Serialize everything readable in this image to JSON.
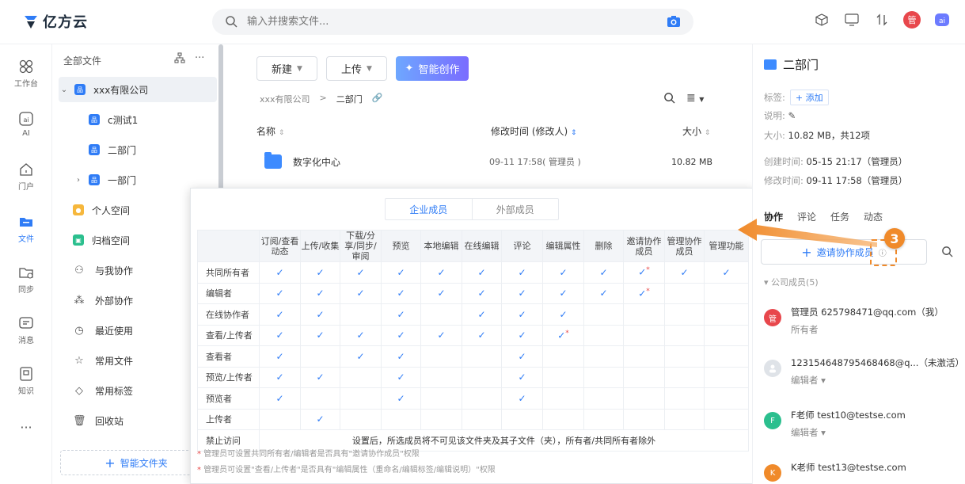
{
  "app": {
    "brand": "亿方云",
    "search_placeholder": "输入并搜索文件...",
    "user_avatar": "管"
  },
  "rail": [
    {
      "label": "工作台",
      "icon": "grid-icon"
    },
    {
      "label": "AI",
      "icon": "ai-icon"
    },
    {
      "label": "门户",
      "icon": "home-icon"
    },
    {
      "label": "文件",
      "icon": "folder-icon",
      "active": true
    },
    {
      "label": "同步",
      "icon": "sync-folder-icon"
    },
    {
      "label": "消息",
      "icon": "message-icon"
    },
    {
      "label": "知识",
      "icon": "knowledge-icon"
    }
  ],
  "tree": {
    "title": "全部文件",
    "items": [
      {
        "label": "xxx有限公司"
      },
      {
        "label": "c测试1"
      },
      {
        "label": "二部门"
      },
      {
        "label": "一部门"
      },
      {
        "label": "个人空间"
      },
      {
        "label": "归档空间"
      },
      {
        "label": "与我协作"
      },
      {
        "label": "外部协作"
      },
      {
        "label": "最近使用"
      },
      {
        "label": "常用文件"
      },
      {
        "label": "常用标签"
      },
      {
        "label": "回收站"
      }
    ],
    "smart_folder": "智能文件夹"
  },
  "main": {
    "new_btn": "新建",
    "upload_btn": "上传",
    "ai_btn": "智能创作",
    "crumb_root": "xxx有限公司",
    "crumb_sep": ">",
    "crumb_current": "二部门",
    "col_name": "名称",
    "col_mtime": "修改时间 (修改人)",
    "col_size": "大小",
    "files": [
      {
        "name": "数字化中心",
        "mtime": "09-11 17:58( 管理员 )",
        "size": "10.82 MB"
      }
    ]
  },
  "popup": {
    "tab_internal": "企业成员",
    "tab_external": "外部成员",
    "headers": [
      "订阅/查看动态",
      "上传/收集",
      "下载/分享/同步/审阅",
      "预览",
      "本地编辑",
      "在线编辑",
      "评论",
      "编辑属性",
      "删除",
      "邀请协作成员",
      "管理协作成员",
      "管理功能"
    ],
    "rows": [
      {
        "role": "共同所有者",
        "perms": [
          1,
          1,
          1,
          1,
          1,
          1,
          1,
          1,
          1,
          2,
          1,
          1
        ]
      },
      {
        "role": "编辑者",
        "perms": [
          1,
          1,
          1,
          1,
          1,
          1,
          1,
          1,
          1,
          2,
          0,
          0
        ]
      },
      {
        "role": "在线协作者",
        "perms": [
          1,
          1,
          0,
          1,
          0,
          1,
          1,
          1,
          0,
          0,
          0,
          0
        ]
      },
      {
        "role": "查看/上传者",
        "perms": [
          1,
          1,
          1,
          1,
          1,
          1,
          1,
          2,
          0,
          0,
          0,
          0
        ]
      },
      {
        "role": "查看者",
        "perms": [
          1,
          0,
          1,
          1,
          0,
          0,
          1,
          0,
          0,
          0,
          0,
          0
        ]
      },
      {
        "role": "预览/上传者",
        "perms": [
          1,
          1,
          0,
          1,
          0,
          0,
          1,
          0,
          0,
          0,
          0,
          0
        ]
      },
      {
        "role": "预览者",
        "perms": [
          1,
          0,
          0,
          1,
          0,
          0,
          1,
          0,
          0,
          0,
          0,
          0
        ]
      },
      {
        "role": "上传者",
        "perms": [
          0,
          1,
          0,
          0,
          0,
          0,
          0,
          0,
          0,
          0,
          0,
          0
        ]
      }
    ],
    "deny_role": "禁止访问",
    "deny_text": "设置后，所选成员将不可见该文件夹及其子文件（夹），所有者/共同所有者除外",
    "note1": "管理员可设置共同所有者/编辑者是否具有\"邀请协作成员\"权限",
    "note2": "管理员可设置\"查看/上传者\"是否具有\"编辑属性（重命名/编辑标签/编辑说明）\"权限"
  },
  "right": {
    "title": "二部门",
    "tag_label": "标签:",
    "tag_add": "+ 添加",
    "desc_label": "说明:",
    "size_label": "大小:",
    "size_value": "10.82 MB，共12项",
    "created_label": "创建时间:",
    "created_value": "05-15 21:17（管理员）",
    "modified_label": "修改时间:",
    "modified_value": "09-11 17:58（管理员）",
    "tabs": [
      "协作",
      "评论",
      "任务",
      "动态"
    ],
    "invite": "邀请协作成员",
    "step": "3",
    "group": "公司成员(5)",
    "members": [
      {
        "avatar": "管",
        "name": "管理员  625798471@qq.com（我）",
        "role": "所有者",
        "color": "#e8474c"
      },
      {
        "avatar": "",
        "name": "123154648795468468@q...（未激活）",
        "role": "编辑者 ▾",
        "color": "#dfe3e8"
      },
      {
        "avatar": "F",
        "name": "F老师  test10@testse.com",
        "role": "编辑者 ▾",
        "color": "#2bbf8e"
      },
      {
        "avatar": "K",
        "name": "K老师  test13@testse.com",
        "role": "",
        "color": "#f08a2a"
      }
    ]
  }
}
